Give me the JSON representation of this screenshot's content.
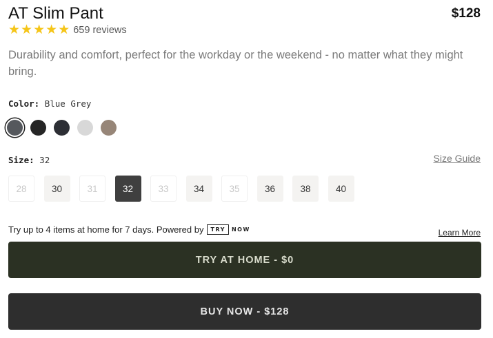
{
  "product": {
    "title": "AT Slim Pant",
    "price": "$128",
    "rating_stars": 5,
    "reviews": "659 reviews",
    "description": "Durability and comfort, perfect for the workday or the weekend - no matter what they might bring."
  },
  "color": {
    "label": "Color:",
    "selected": "Blue Grey",
    "swatches": [
      {
        "name": "Blue Grey",
        "hex": "#55585d",
        "selected": true
      },
      {
        "name": "",
        "hex": "#262626",
        "selected": false
      },
      {
        "name": "",
        "hex": "#2d2f35",
        "selected": false
      },
      {
        "name": "",
        "hex": "#d8d8d8",
        "selected": false
      },
      {
        "name": "",
        "hex": "#978678",
        "selected": false
      }
    ]
  },
  "size": {
    "label": "Size:",
    "selected": "32",
    "guide_label": "Size Guide",
    "options": [
      {
        "value": "28",
        "available": false
      },
      {
        "value": "30",
        "available": true
      },
      {
        "value": "31",
        "available": false
      },
      {
        "value": "32",
        "available": true,
        "selected": true
      },
      {
        "value": "33",
        "available": false
      },
      {
        "value": "34",
        "available": true
      },
      {
        "value": "35",
        "available": false
      },
      {
        "value": "36",
        "available": true
      },
      {
        "value": "38",
        "available": true
      },
      {
        "value": "40",
        "available": true
      }
    ]
  },
  "try_at_home": {
    "text": "Try up to 4 items at home for 7 days. Powered by",
    "logo_try": "TRY",
    "logo_now": "NOW",
    "learn_more": "Learn More"
  },
  "buttons": {
    "try_label": "TRY AT HOME - $0",
    "buy_label": "BUY NOW - $128"
  },
  "colors": {
    "star": "#f5c518",
    "try_button_bg": "#2b3123",
    "buy_button_bg": "#2e2e2e",
    "selected_size_bg": "#3f3f3f"
  }
}
